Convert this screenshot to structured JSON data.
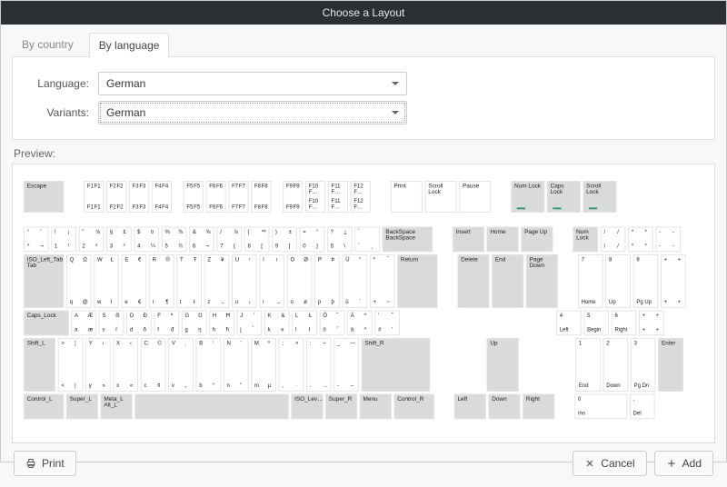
{
  "window": {
    "title": "Choose a Layout"
  },
  "tabs": {
    "country": "By country",
    "language": "By language"
  },
  "form": {
    "language_label": "Language:",
    "language_value": "German",
    "variants_label": "Variants:",
    "variants_value": "German"
  },
  "preview_label": "Preview:",
  "actions": {
    "print": "Print",
    "cancel": "Cancel",
    "add": "Add"
  },
  "keys": {
    "escape": "Escape",
    "frow_top": [
      "F1",
      "F1",
      "F2",
      "F2",
      "F3",
      "F3",
      "F4",
      "F4",
      "F5",
      "F5",
      "F6",
      "F6",
      "F7",
      "F7",
      "F8",
      "F8",
      "F9",
      "F9",
      "F10 F…",
      "F11 F…",
      "F12 F…"
    ],
    "frow_bot": [
      "F1",
      "F1",
      "F2",
      "F2",
      "F3",
      "F3",
      "F4",
      "F4",
      "F5",
      "F5",
      "F6",
      "F6",
      "F7",
      "F7",
      "F8",
      "F8",
      "F9",
      "F9",
      "F10 F…",
      "F11 F…",
      "F12 F…"
    ],
    "print": "Print",
    "scroll_lock": "Scroll Lock",
    "pause": "Pause",
    "num_lock": "Num Lock",
    "caps_lock_ind": "Caps Lock",
    "scroll_lock_ind": "Scroll Lock",
    "row1": [
      {
        "t": [
          "°",
          "′"
        ],
        "b": [
          "^",
          "¬"
        ]
      },
      {
        "t": [
          "!",
          "¡"
        ],
        "b": [
          "1",
          "¹"
        ]
      },
      {
        "t": [
          "\"",
          "⅛"
        ],
        "b": [
          "2",
          "²"
        ]
      },
      {
        "t": [
          "§",
          "£"
        ],
        "b": [
          "3",
          "³"
        ]
      },
      {
        "t": [
          "$",
          "¤"
        ],
        "b": [
          "4",
          "¼"
        ]
      },
      {
        "t": [
          "%",
          "⅜"
        ],
        "b": [
          "5",
          "½"
        ]
      },
      {
        "t": [
          "&",
          "⅝"
        ],
        "b": [
          "6",
          "¬"
        ]
      },
      {
        "t": [
          "/",
          "⅞"
        ],
        "b": [
          "7",
          "{"
        ]
      },
      {
        "t": [
          "(",
          "™"
        ],
        "b": [
          "8",
          "["
        ]
      },
      {
        "t": [
          ")",
          "±"
        ],
        "b": [
          "9",
          "]"
        ]
      },
      {
        "t": [
          "=",
          "°"
        ],
        "b": [
          "0",
          "}"
        ]
      },
      {
        "t": [
          "?",
          "¿"
        ],
        "b": [
          "ß",
          "\\"
        ]
      },
      {
        "t": [
          "`",
          ""
        ],
        "b": [
          "´",
          "¸"
        ]
      }
    ],
    "backspace": "BackSpace",
    "row2_tab": "ISO_Left_Tab",
    "row2_tab2": "Tab",
    "row2": [
      {
        "t": [
          "Q",
          "Ω"
        ],
        "b": [
          "q",
          "@"
        ]
      },
      {
        "t": [
          "W",
          "Ł"
        ],
        "b": [
          "w",
          "ł"
        ]
      },
      {
        "t": [
          "E",
          "€"
        ],
        "b": [
          "e",
          "€"
        ]
      },
      {
        "t": [
          "R",
          "®"
        ],
        "b": [
          "r",
          "¶"
        ]
      },
      {
        "t": [
          "T",
          "Ŧ"
        ],
        "b": [
          "t",
          "ŧ"
        ]
      },
      {
        "t": [
          "Z",
          "¥"
        ],
        "b": [
          "z",
          "←"
        ]
      },
      {
        "t": [
          "U",
          "↑"
        ],
        "b": [
          "u",
          "↓"
        ]
      },
      {
        "t": [
          "I",
          "ı"
        ],
        "b": [
          "i",
          "→"
        ]
      },
      {
        "t": [
          "O",
          "Ø"
        ],
        "b": [
          "o",
          "ø"
        ]
      },
      {
        "t": [
          "P",
          "Þ"
        ],
        "b": [
          "p",
          "þ"
        ]
      },
      {
        "t": [
          "Ü",
          "°"
        ],
        "b": [
          "ü",
          "¨"
        ]
      },
      {
        "t": [
          "*",
          "¯"
        ],
        "b": [
          "+",
          "~"
        ]
      }
    ],
    "return": "Return",
    "caps_lock": "Caps_Lock",
    "row3": [
      {
        "t": [
          "A",
          "Æ"
        ],
        "b": [
          "a",
          "æ"
        ]
      },
      {
        "t": [
          "S",
          "ẞ"
        ],
        "b": [
          "s",
          "ſ"
        ]
      },
      {
        "t": [
          "D",
          "Ð"
        ],
        "b": [
          "d",
          "ð"
        ]
      },
      {
        "t": [
          "F",
          "ª"
        ],
        "b": [
          "f",
          "đ"
        ]
      },
      {
        "t": [
          "G",
          "Ŋ"
        ],
        "b": [
          "g",
          "ŋ"
        ]
      },
      {
        "t": [
          "H",
          "Ħ"
        ],
        "b": [
          "h",
          "ħ"
        ]
      },
      {
        "t": [
          "J",
          "̛"
        ],
        "b": [
          "j",
          "̉"
        ]
      },
      {
        "t": [
          "K",
          "&"
        ],
        "b": [
          "k",
          "ĸ"
        ]
      },
      {
        "t": [
          "L",
          "Ł"
        ],
        "b": [
          "l",
          "ł"
        ]
      },
      {
        "t": [
          "Ö",
          "˝"
        ],
        "b": [
          "ö",
          "˝"
        ]
      },
      {
        "t": [
          "Ä",
          "^"
        ],
        "b": [
          "ä",
          "^"
        ]
      },
      {
        "t": [
          "'",
          "˘"
        ],
        "b": [
          "#",
          "'"
        ]
      }
    ],
    "shift_l": "Shift_L",
    "shift_r": "Shift_R",
    "row4lead": {
      "t": [
        ">",
        "¦"
      ],
      "b": [
        "<",
        "|"
      ]
    },
    "row4": [
      {
        "t": [
          "Y",
          "›"
        ],
        "b": [
          "y",
          "»"
        ]
      },
      {
        "t": [
          "X",
          "‹"
        ],
        "b": [
          "x",
          "«"
        ]
      },
      {
        "t": [
          "C",
          "©"
        ],
        "b": [
          "c",
          "¢"
        ]
      },
      {
        "t": [
          "V",
          "‚"
        ],
        "b": [
          "v",
          "„"
        ]
      },
      {
        "t": [
          "B",
          "‘"
        ],
        "b": [
          "b",
          "“"
        ]
      },
      {
        "t": [
          "N",
          "’"
        ],
        "b": [
          "n",
          "”"
        ]
      },
      {
        "t": [
          "M",
          "º"
        ],
        "b": [
          "m",
          "µ"
        ]
      },
      {
        "t": [
          ";",
          "×"
        ],
        "b": [
          ",",
          "·"
        ]
      },
      {
        "t": [
          ":",
          "÷"
        ],
        "b": [
          ".",
          "…"
        ]
      },
      {
        "t": [
          "_",
          "—"
        ],
        "b": [
          "-",
          "–"
        ]
      }
    ],
    "control_l": "Control_L",
    "super_l": "Super_L",
    "alt_l": "Alt_L",
    "meta_l": "Meta_L",
    "iso_lev": "ISO_Lev…",
    "super_r": "Super_R",
    "menu": "Menu",
    "control_r": "Control_R",
    "nav": {
      "insert": "Insert",
      "home": "Home",
      "pageup": "Page Up",
      "delete": "Delete",
      "end": "End",
      "pagedown": "Page Down",
      "up": "Up",
      "left": "Left",
      "down": "Down",
      "right": "Right"
    },
    "numpad": {
      "numlock": "Num Lock",
      "div": {
        "t": [
          "/",
          "/"
        ],
        "b": [
          "/",
          "/"
        ]
      },
      "mul": {
        "t": [
          "*",
          "*"
        ],
        "b": [
          "*",
          "*"
        ]
      },
      "sub": {
        "t": [
          "-",
          "-"
        ],
        "b": [
          "-",
          "-"
        ]
      },
      "add": {
        "t": [
          "+",
          "+"
        ],
        "b": [
          "+",
          "+"
        ]
      },
      "enter": "Enter",
      "7": {
        "n": "7",
        "l": "Home"
      },
      "8": {
        "n": "8",
        "l": "Up"
      },
      "9": {
        "n": "9",
        "l": "Pg Up"
      },
      "4": {
        "n": "4",
        "l": "Left"
      },
      "5": {
        "n": "5",
        "l": "Begin"
      },
      "6": {
        "n": "6",
        "l": "Right"
      },
      "1": {
        "n": "1",
        "l": "End"
      },
      "2": {
        "n": "2",
        "l": "Down"
      },
      "3": {
        "n": "3",
        "l": "Pg Dn"
      },
      "0": {
        "n": "0",
        "l": "Ins"
      },
      "dot": {
        "n": ",",
        "l": "Del"
      }
    }
  }
}
